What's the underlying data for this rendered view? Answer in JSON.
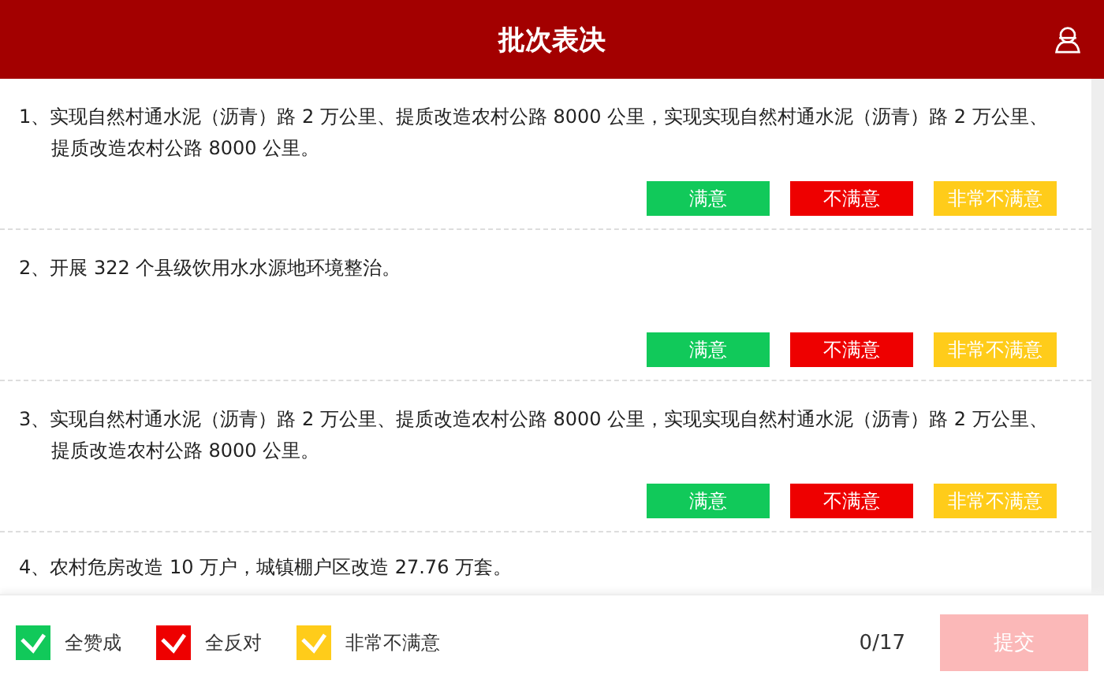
{
  "header": {
    "title": "批次表决"
  },
  "items": [
    {
      "text": "1、实现自然村通水泥（沥青）路 2 万公里、提质改造农村公路 8000 公里，实现实现自然村通水泥（沥青）路 2 万公里、提质改造农村公路 8000 公里。",
      "buttons": [
        {
          "label": "满意",
          "color": "#11c95a"
        },
        {
          "label": "不满意",
          "color": "#ee0000"
        },
        {
          "label": "非常不满意",
          "color": "#ffcc1a"
        }
      ]
    },
    {
      "text": "2、开展 322 个县级饮用水水源地环境整治。",
      "buttons": [
        {
          "label": "满意",
          "color": "#11c95a"
        },
        {
          "label": "不满意",
          "color": "#ee0000"
        },
        {
          "label": "非常不满意",
          "color": "#ffcc1a"
        }
      ]
    },
    {
      "text": "3、实现自然村通水泥（沥青）路 2 万公里、提质改造农村公路 8000 公里，实现实现自然村通水泥（沥青）路 2 万公里、提质改造农村公路 8000 公里。",
      "buttons": [
        {
          "label": "满意",
          "color": "#11c95a"
        },
        {
          "label": "不满意",
          "color": "#ee0000"
        },
        {
          "label": "非常不满意",
          "color": "#ffcc1a"
        }
      ]
    },
    {
      "text": "4、农村危房改造 10 万户，城镇棚户区改造 27.76 万套。"
    }
  ],
  "footer": {
    "options": [
      {
        "label": "全赞成",
        "checked": true,
        "color": "#11c95a"
      },
      {
        "label": "全反对",
        "checked": true,
        "color": "#ee0000"
      },
      {
        "label": "非常不满意",
        "checked": true,
        "color": "#ffcc1a"
      }
    ],
    "progress": "0/17",
    "submit": {
      "label": "提交",
      "disabled": true
    }
  }
}
